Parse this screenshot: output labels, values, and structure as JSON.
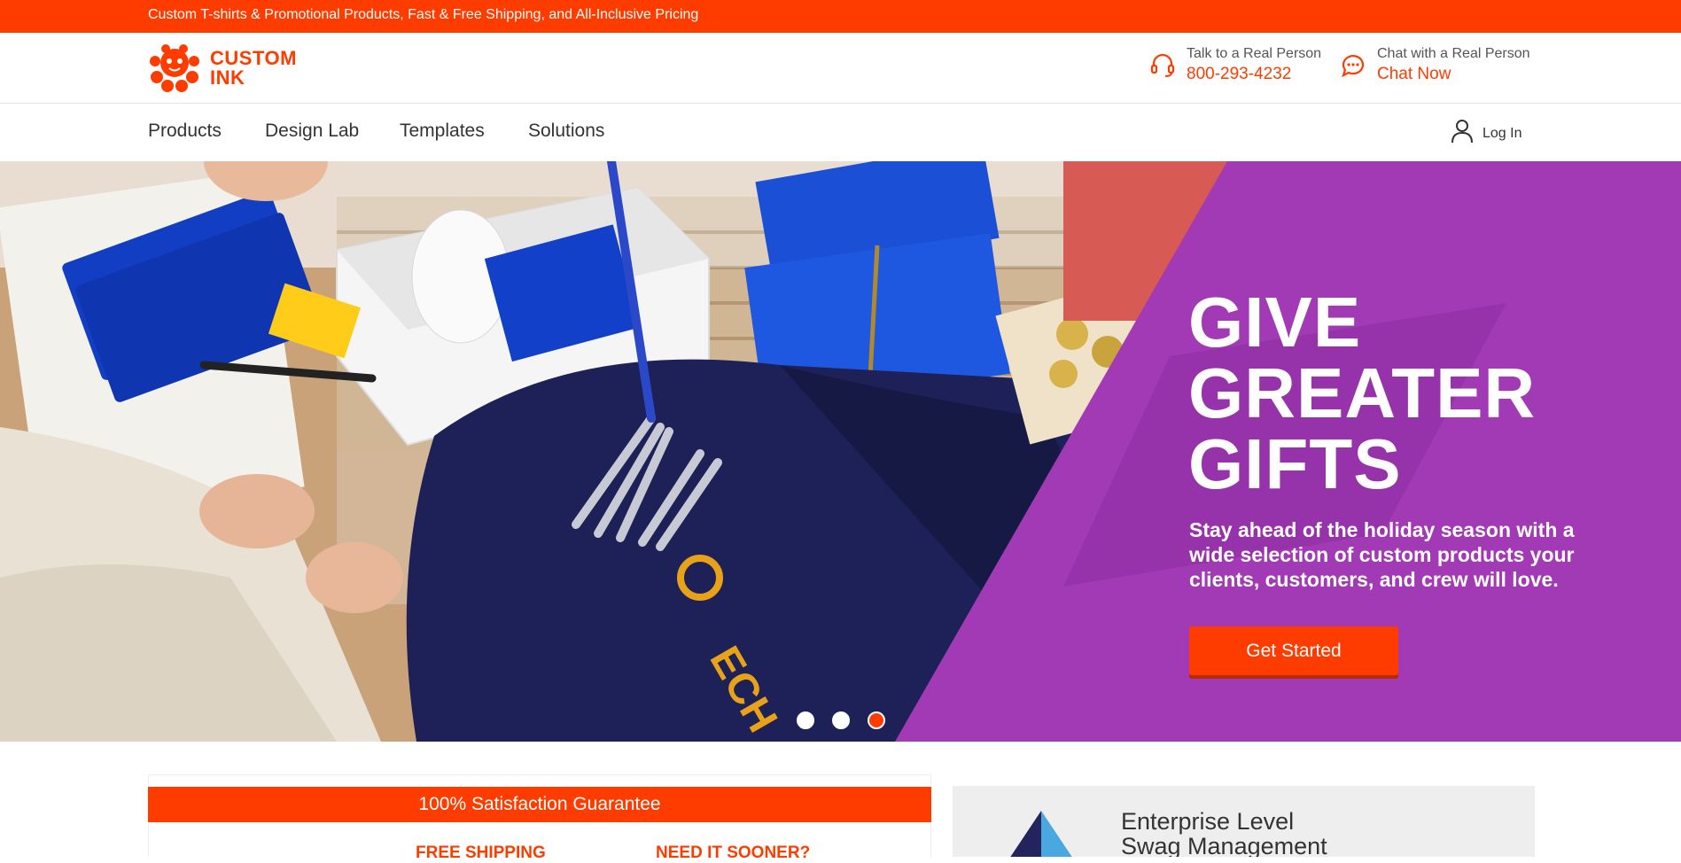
{
  "promo_bar": {
    "text": "Custom T-shirts & Promotional Products, Fast & Free Shipping, and All-Inclusive Pricing"
  },
  "logo": {
    "line1": "CUSTOM",
    "line2": "INK",
    "icon": "octopus-logo"
  },
  "contact": {
    "phone": {
      "label": "Talk to a Real Person",
      "value": "800-293-4232",
      "icon": "headset-icon"
    },
    "chat": {
      "label": "Chat with a Real Person",
      "value": "Chat Now",
      "icon": "chat-icon"
    }
  },
  "nav": {
    "items": [
      {
        "label": "Products"
      },
      {
        "label": "Design Lab"
      },
      {
        "label": "Templates"
      },
      {
        "label": "Solutions"
      }
    ],
    "login": {
      "label": "Log In",
      "icon": "user-icon"
    }
  },
  "hero": {
    "title_lines": [
      "GIVE",
      "GREATER",
      "GIFTS"
    ],
    "subtitle": "Stay ahead of the holiday season with a wide selection of custom products your clients, customers, and crew will love.",
    "cta": "Get Started",
    "slides": 3,
    "active_slide": 3
  },
  "guarantee": {
    "banner": "100% Satisfaction Guarantee",
    "link1": "FREE SHIPPING",
    "link2": "NEED IT SOONER?"
  },
  "enterprise": {
    "line1": "Enterprise Level",
    "line2": "Swag Management"
  },
  "colors": {
    "brand": "#ff3c00",
    "hero_purple": "#a33ab5",
    "navy": "#23245e",
    "cta_shadow": "#b82a00"
  }
}
